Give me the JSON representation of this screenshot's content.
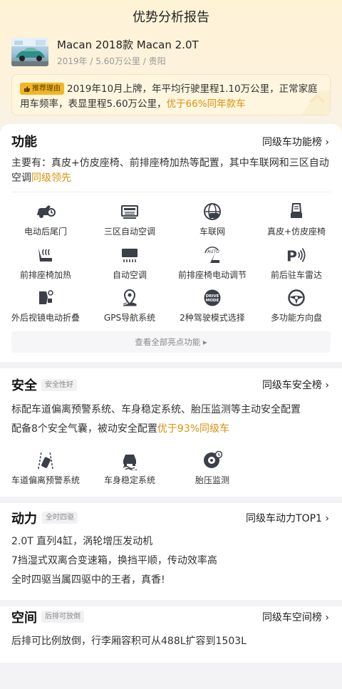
{
  "header": {
    "title": "优势分析报告"
  },
  "car": {
    "name": "Macan 2018款 Macan 2.0T",
    "meta": "2019年 / 5.60万公里 / 贵阳"
  },
  "reason": {
    "tag": "推荐理由",
    "text": "2019年10月上牌，年平均行驶里程1.10万公里，正常家庭用车频率，表显里程5.60万公里，",
    "highlight": "优于66%同年款车"
  },
  "function": {
    "title": "功能",
    "link": "同级车功能榜",
    "desc": "主要有：真皮+仿皮座椅、前排座椅加热等配置，其中车联网和三区自动空调",
    "desc_highlight": "同级领先",
    "items": [
      {
        "label": "电动后尾门",
        "icon": "tailgate-icon"
      },
      {
        "label": "三区自动空调",
        "icon": "climate-icon"
      },
      {
        "label": "车联网",
        "icon": "connected-car-icon"
      },
      {
        "label": "真皮+仿皮座椅",
        "icon": "leather-seat-icon"
      },
      {
        "label": "前排座椅加热",
        "icon": "seat-heating-icon"
      },
      {
        "label": "自动空调",
        "icon": "auto-ac-icon"
      },
      {
        "label": "前排座椅电动调节",
        "icon": "power-seat-icon"
      },
      {
        "label": "前后驻车雷达",
        "icon": "parking-radar-icon"
      },
      {
        "label": "外后视镜电动折叠",
        "icon": "mirror-fold-icon"
      },
      {
        "label": "GPS导航系统",
        "icon": "gps-icon"
      },
      {
        "label": "2种驾驶模式选择",
        "icon": "drive-mode-icon"
      },
      {
        "label": "多功能方向盘",
        "icon": "steering-wheel-icon"
      }
    ],
    "view_all": "查看全部亮点功能 ▸"
  },
  "safety": {
    "title": "安全",
    "badge": "安全性好",
    "link": "同级车安全榜",
    "line1": "标配车道偏离预警系统、车身稳定系统、胎压监测等主动安全配置",
    "line2": "配备8个安全气囊，被动安全配置",
    "line2_highlight": "优于93%同级车",
    "items": [
      {
        "label": "车道偏离预警系统",
        "icon": "lane-departure-icon"
      },
      {
        "label": "车身稳定系统",
        "icon": "stability-icon"
      },
      {
        "label": "胎压监测",
        "icon": "tire-pressure-icon"
      }
    ]
  },
  "power": {
    "title": "动力",
    "badge": "全时四驱",
    "link": "同级车动力TOP1",
    "lines": [
      "2.0T 直列4缸，涡轮增压发动机",
      "7挡湿式双离合变速箱，换挡平顺，传动效率高",
      "全时四驱当属四驱中的王者，真香!"
    ]
  },
  "space": {
    "title": "空间",
    "badge": "后排可放倒",
    "link": "同级车空间榜",
    "line": "后排可比例放倒，行李厢容积可从488L扩容到1503L"
  },
  "colors": {
    "accent": "#d9920a",
    "tag_bg": "#f3b623",
    "icon": "#3b3f4a"
  }
}
